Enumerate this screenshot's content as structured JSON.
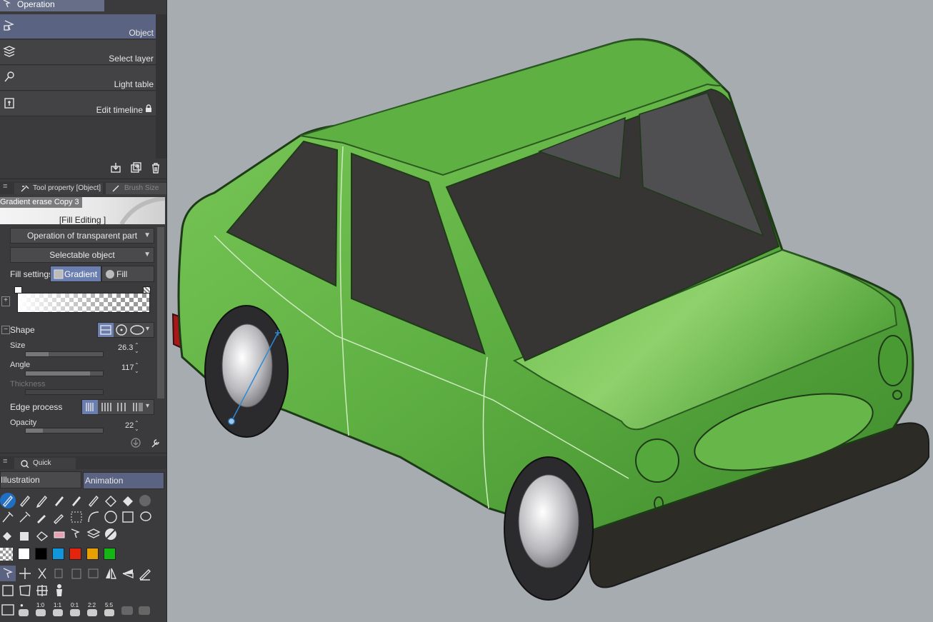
{
  "operation_panel": {
    "title": "Operation",
    "subtools": [
      {
        "label": "Object",
        "icon": "object-select-icon",
        "selected": true
      },
      {
        "label": "Select layer",
        "icon": "select-layer-icon",
        "selected": false
      },
      {
        "label": "Light table",
        "icon": "light-table-icon",
        "selected": false
      },
      {
        "label": "Edit timeline",
        "icon": "edit-timeline-icon",
        "selected": false,
        "locked": true
      }
    ],
    "footer_icons": [
      "import-icon",
      "duplicate-icon",
      "trash-icon"
    ]
  },
  "tool_property": {
    "tabs": [
      {
        "label": "Tool property [Object]",
        "icon": "tool-property-icon"
      },
      {
        "label": "Brush Size",
        "icon": "brush-size-icon"
      }
    ],
    "preset_name": "Gradient erase Copy 3",
    "mode_title": "[Fill Editing ]",
    "transparent_operation": "Operation of transparent part",
    "selectable": "Selectable object",
    "fill_settings": {
      "label": "Fill settings",
      "options": [
        "Gradient",
        "Fill"
      ],
      "selected": "Gradient"
    },
    "shape": {
      "label": "Shape",
      "options": [
        "linear-shape-icon",
        "circle-shape-icon",
        "ellipse-shape-icon"
      ]
    },
    "size": {
      "label": "Size",
      "value": "26.3",
      "level": 0.3
    },
    "angle": {
      "label": "Angle",
      "value": "117",
      "level": 0.83
    },
    "thickness": {
      "label": "Thickness",
      "level": 0
    },
    "edge_process": {
      "label": "Edge process",
      "options": [
        "repeat-icon",
        "reflect-icon",
        "no-repeat-icon",
        "cut-icon"
      ]
    },
    "opacity": {
      "label": "Opacity",
      "value": "22",
      "level": 0.22
    }
  },
  "quick_access": {
    "title": "Quick Access",
    "sets": [
      "Illustration",
      "Animation"
    ],
    "selected_set": "Animation",
    "colors": [
      "#ffffff",
      "#000000",
      "#1296db",
      "#e6230c",
      "#e8a000",
      "#14b614"
    ],
    "ratio_labels": [
      "1:0",
      "1:1",
      "0:1",
      "2:2",
      "5:5"
    ]
  },
  "colors": {
    "panel_bg": "#3b3b3d",
    "selection": "#5a6382",
    "accent_blue": "#1f6fc2",
    "canvas_bg": "#a6acaf",
    "car_body": "#5fb043",
    "gradient_line": "#2c8ad6"
  }
}
